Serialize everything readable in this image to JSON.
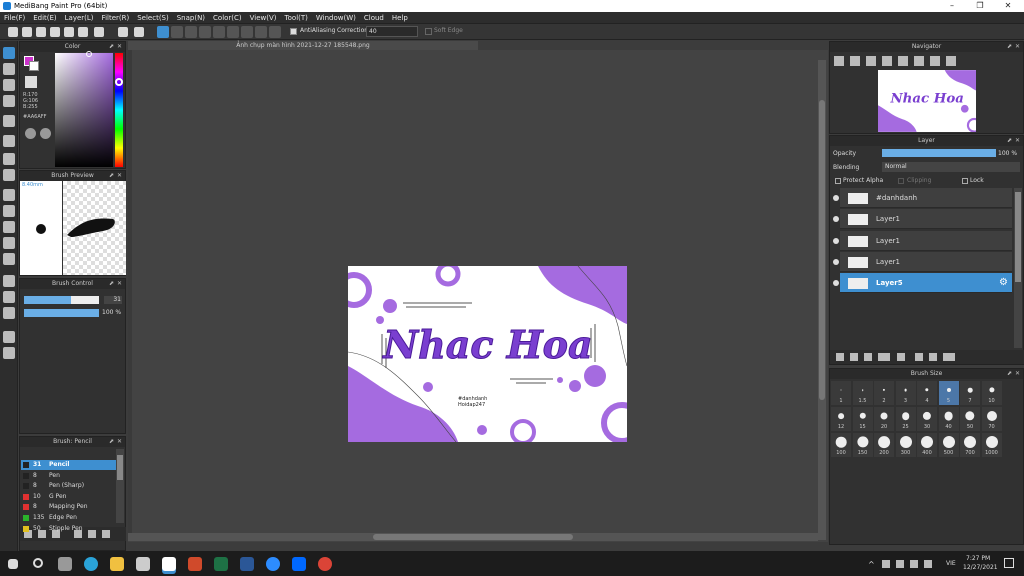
{
  "window": {
    "title": "MediBang Paint Pro (64bit)",
    "min": "–",
    "max": "❐",
    "close": "✕"
  },
  "menu": [
    "File(F)",
    "Edit(E)",
    "Layer(L)",
    "Filter(R)",
    "Select(S)",
    "Snap(N)",
    "Color(C)",
    "View(V)",
    "Tool(T)",
    "Window(W)",
    "Cloud",
    "Help"
  ],
  "toolbar": {
    "antialias_label": "AntiAliasing",
    "correction_label": "Correction",
    "correction_value": "40",
    "soft_edge_label": "Soft Edge"
  },
  "document": {
    "tab_title": "Ảnh chụp màn hình 2021-12-27 185548.png"
  },
  "artwork": {
    "title_text": "Nhac Hoa",
    "tag1": "#danhdanh",
    "tag2": "Hoidap247",
    "purple": "#a56be0",
    "deep": "#6a2bbf"
  },
  "color_panel": {
    "title": "Color",
    "r": "R:170",
    "g": "G:106",
    "b": "B:255",
    "hex": "#AA6AFF",
    "fg": "#cc33cc"
  },
  "brush_preview": {
    "title": "Brush Preview",
    "size": "8.40mm"
  },
  "brush_control": {
    "title": "Brush Control",
    "size_value": "31",
    "opacity_value": "100 %",
    "size_fill": 0.62,
    "opacity_fill": 1.0
  },
  "brush_list": {
    "title": "Brush: Pencil",
    "items": [
      {
        "size": "31",
        "name": "Pencil",
        "color": "#222222",
        "selected": true
      },
      {
        "size": "8",
        "name": "Pen",
        "color": "#222222"
      },
      {
        "size": "8",
        "name": "Pen (Sharp)",
        "color": "#222222"
      },
      {
        "size": "10",
        "name": "G Pen",
        "color": "#e03131"
      },
      {
        "size": "8",
        "name": "Mapping Pen",
        "color": "#e03131"
      },
      {
        "size": "135",
        "name": "Edge Pen",
        "color": "#2bb32b"
      },
      {
        "size": "50",
        "name": "Stipple Pen",
        "color": "#e0c020"
      }
    ]
  },
  "navigator": {
    "title": "Navigator"
  },
  "layer_panel": {
    "title": "Layer",
    "opacity_label": "Opacity",
    "opacity_value": "100 %",
    "opacity_fill": 1.0,
    "blending_label": "Blending",
    "blending_value": "Normal",
    "protect_alpha": "Protect Alpha",
    "clipping": "Clipping",
    "lock": "Lock",
    "layers": [
      {
        "name": "#danhdanh"
      },
      {
        "name": "Layer1"
      },
      {
        "name": "Layer1"
      },
      {
        "name": "Layer1"
      },
      {
        "name": "Layer5",
        "selected": true
      }
    ]
  },
  "brush_size": {
    "title": "Brush Size",
    "sizes": [
      "1",
      "1.5",
      "2",
      "3",
      "4",
      "5",
      "7",
      "10",
      "12",
      "15",
      "20",
      "25",
      "30",
      "40",
      "50",
      "70",
      "100",
      "150",
      "200",
      "300",
      "400",
      "500",
      "700",
      "1000"
    ],
    "selected": "5"
  },
  "taskbar": {
    "time": "7:27 PM",
    "date": "12/27/2021",
    "lang": "VIE"
  }
}
